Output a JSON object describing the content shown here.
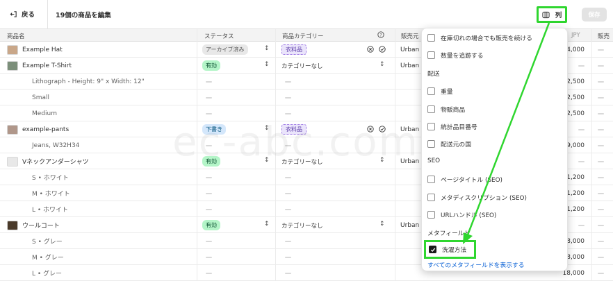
{
  "topbar": {
    "back_label": "戻る",
    "title": "19個の商品を編集",
    "columns_label": "列",
    "save_label": "保存"
  },
  "table": {
    "headers": {
      "name": "商品名",
      "status": "ステータス",
      "category": "商品カテゴリー",
      "vendor": "販売元",
      "currency": "JPY",
      "sales": "販売"
    },
    "rows": [
      {
        "name": "Example Hat",
        "status": "アーカイブ済み",
        "category": "衣料品",
        "vendor": "Urban",
        "price": "4,000"
      },
      {
        "name": "Example T-Shirt",
        "status": "有効",
        "category": "カテゴリーなし",
        "vendor": "Urban",
        "price": ""
      },
      {
        "name": "Lithograph - Height: 9\" x Width: 12\"",
        "price": "2,500"
      },
      {
        "name": "Small",
        "price": "2,500"
      },
      {
        "name": "Medium",
        "price": "2,500"
      },
      {
        "name": "example-pants",
        "status": "下書き",
        "category": "衣料品",
        "vendor": "Urban",
        "price": ""
      },
      {
        "name": "Jeans, W32H34",
        "price": "9,000"
      },
      {
        "name": "Vネックアンダーシャツ",
        "status": "有効",
        "category": "カテゴリーなし",
        "vendor": "Urban",
        "price": ""
      },
      {
        "name": "S • ホワイト",
        "price": "1,200"
      },
      {
        "name": "M • ホワイト",
        "price": "1,200"
      },
      {
        "name": "L • ホワイト",
        "price": "1,200"
      },
      {
        "name": "ウールコート",
        "status": "有効",
        "category": "カテゴリーなし",
        "vendor": "Urban",
        "price": ""
      },
      {
        "name": "S • グレー",
        "price": "8,000"
      },
      {
        "name": "M • グレー",
        "price": "8,000"
      },
      {
        "name": "L • グレー",
        "price": "18,000"
      }
    ]
  },
  "dropdown": {
    "items_top": [
      "在庫切れの場合でも販売を続ける",
      "数量を追跡する"
    ],
    "section_shipping": "配送",
    "items_shipping": [
      "重量",
      "物販商品",
      "統計品目番号",
      "配送元の国"
    ],
    "section_seo": "SEO",
    "items_seo": [
      "ページタイトル (SEO)",
      "メタディスクリプション (SEO)",
      "URLハンドル (SEO)"
    ],
    "section_metafields": "メタフィールド",
    "checked_item": "洗濯方法",
    "show_all_link": "すべてのメタフィールドを表示する"
  },
  "watermark": "ec-abc.com",
  "colors": {
    "highlight": "#2fd62f",
    "link": "#005bd3",
    "active_badge": "#b4f5c8",
    "draft_badge": "#d4e7fb",
    "category_chip": "#eae4fb"
  }
}
